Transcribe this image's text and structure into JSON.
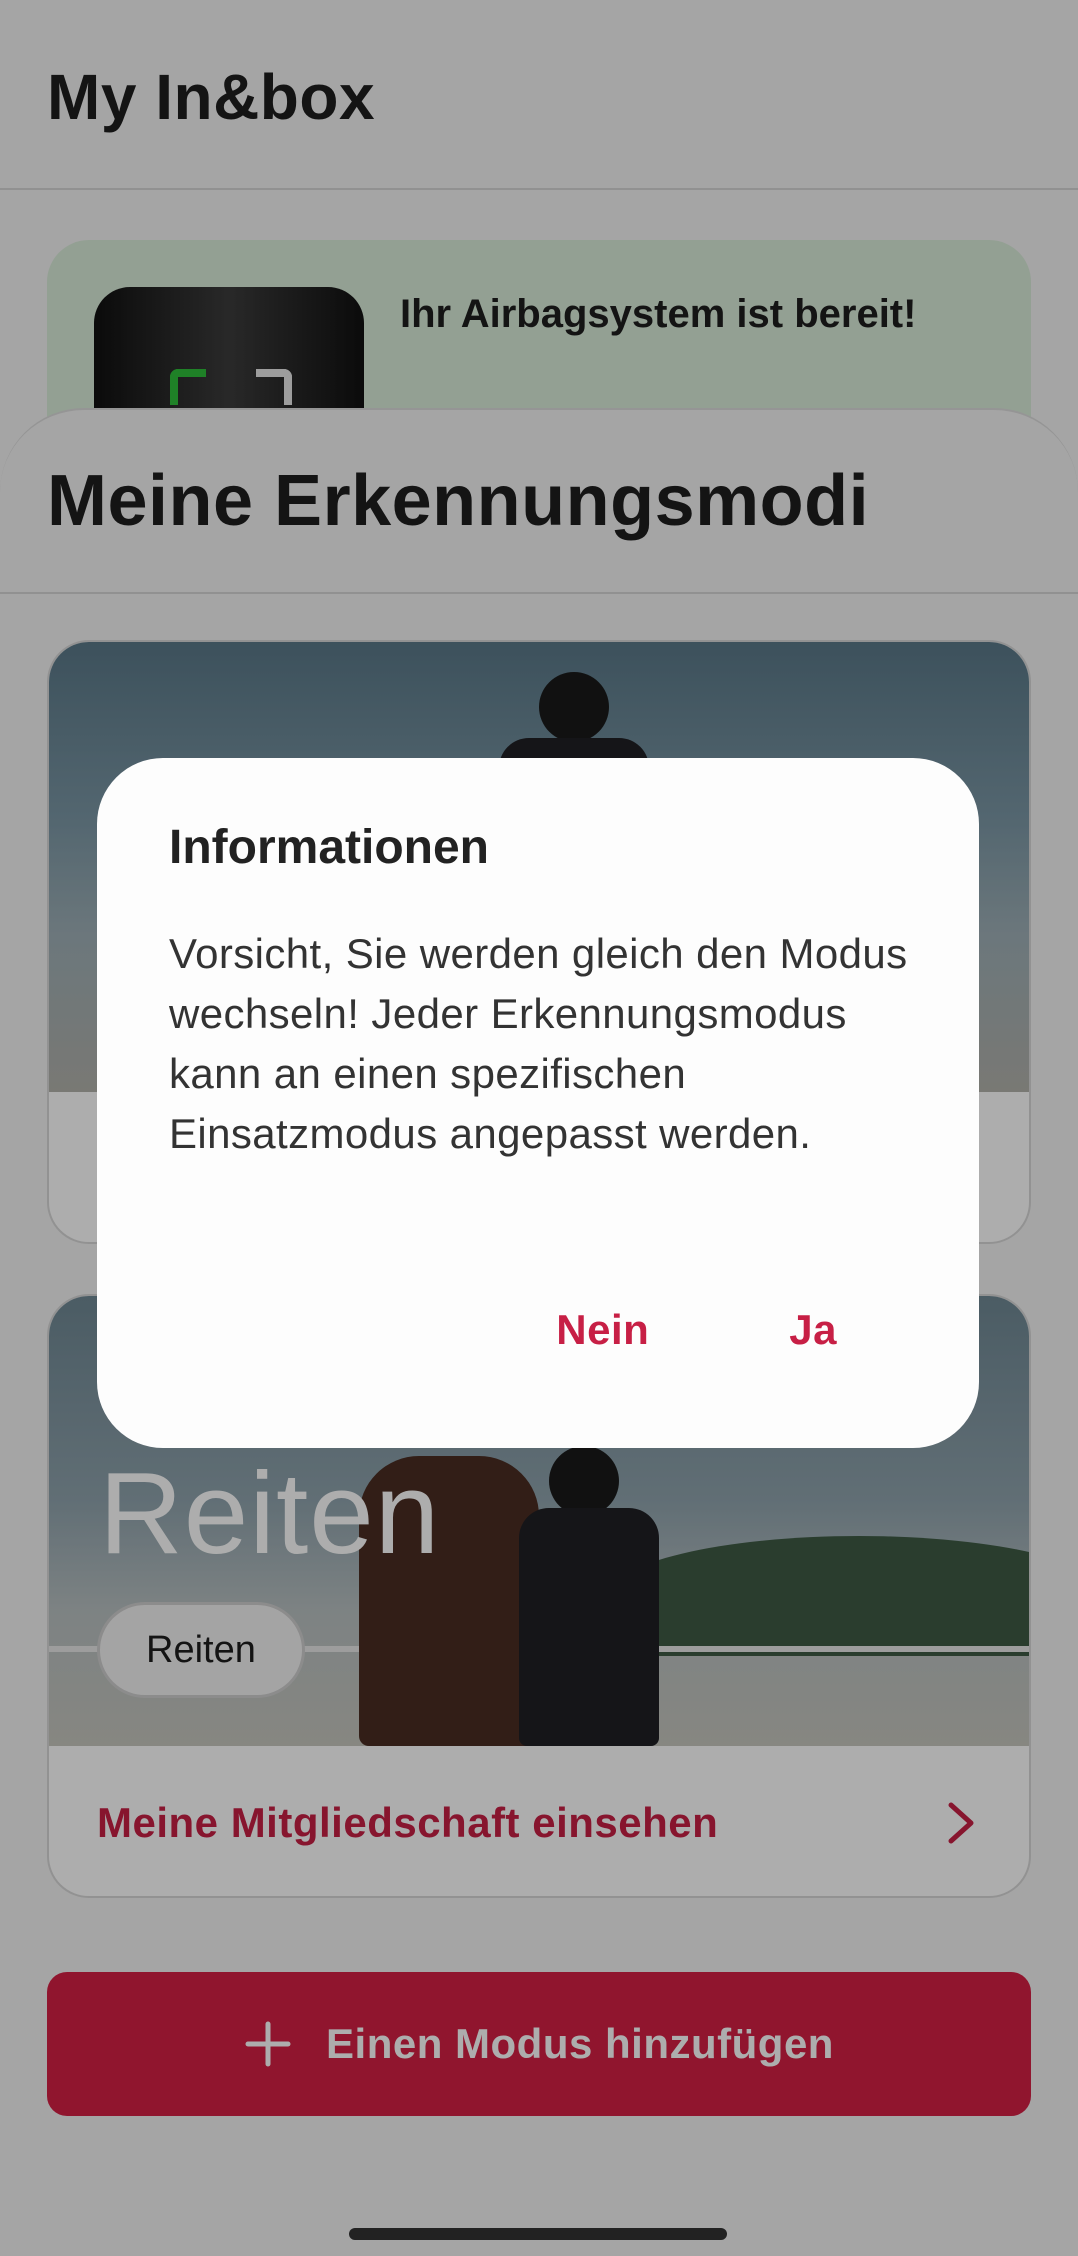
{
  "header": {
    "title": "My In&box"
  },
  "inbox_card": {
    "message": "Ihr Airbagsystem ist bereit!"
  },
  "sheet": {
    "title": "Meine Erkennungsmodi"
  },
  "mode_cards": [
    {
      "link_label": ""
    },
    {
      "mode_title": "Reiten",
      "chip_label": "Reiten",
      "link_label": "Meine Mitgliedschaft einsehen"
    }
  ],
  "add_mode": {
    "label": "Einen Modus hinzufügen"
  },
  "dialog": {
    "title": "Informationen",
    "body": "Vorsicht, Sie werden gleich den Modus wechseln! Jeder Erkennungsmodus kann an einen spezifischen Einsatzmodus angepasst werden.",
    "cancel_label": "Nein",
    "confirm_label": "Ja"
  },
  "colors": {
    "accent": "#c71f45",
    "button_bg": "#d41f45",
    "inbox_card_bg": "#d9ecd9"
  }
}
